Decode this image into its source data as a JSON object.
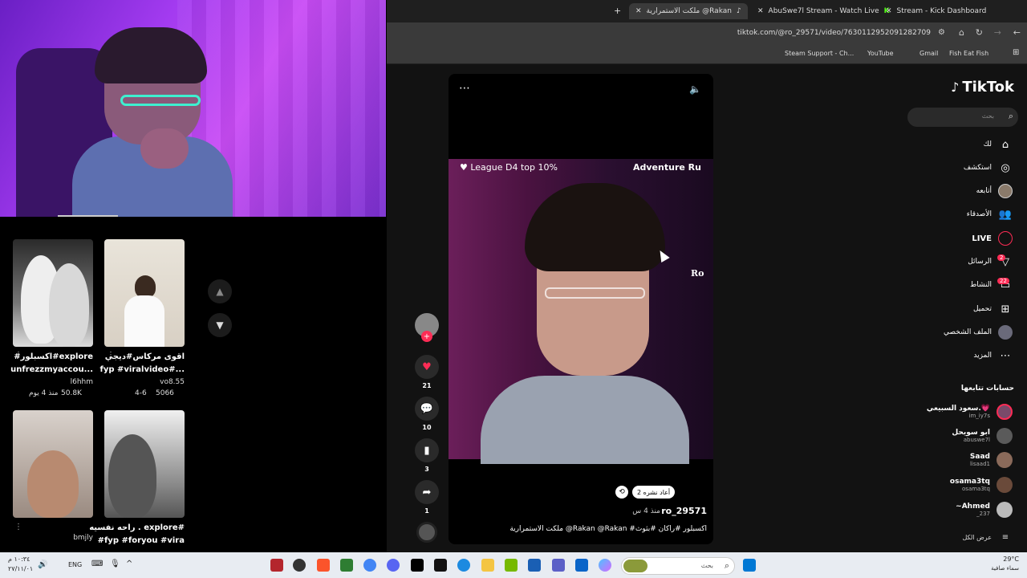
{
  "browser": {
    "tabs": [
      {
        "label": "ملكت الاستمرارية @Rakan",
        "active": true
      },
      {
        "label": "AbuSwe7l Stream - Watch Live",
        "active": false
      },
      {
        "label": "Stream - Kick Dashboard",
        "active": false
      }
    ],
    "url": "tiktok.com/@ro_29571/video/7630112952091282709",
    "bookmarks": [
      "Steam Support - Ch...",
      "YouTube",
      "Gmail",
      "Fish Eat Fish"
    ]
  },
  "feed": {
    "videos": [
      {
        "title": "#اكسبلور#explore",
        "title2": "unfrezzmyaccou...",
        "author": "l6hhm",
        "likes": "50.8K",
        "age": "منذ 4 يوم"
      },
      {
        "title": "اقوى مركاس#ديجي",
        "title2": "fyp #viralvideo#...",
        "author": "vo8.55",
        "likes": "5066",
        "age": "4-6"
      },
      {
        "title": "",
        "title2": "",
        "author": "bmjly",
        "likes": "",
        "age": ""
      },
      {
        "title": "راحه نفسيه . explore#",
        "title2": "#fyp #foryou #vira",
        "author": "",
        "likes": "",
        "age": ""
      }
    ]
  },
  "player": {
    "league": "League D4 top 10%",
    "game": "Adventure Ru",
    "ro_label": "Ro",
    "reposts": "2 أعاد نشره",
    "username": "ro_29571",
    "posted": "منذ 4 س",
    "caption": "ملكت الاستمرارية @Rakan @Rakan #اكسبلور #راكان #بثوث"
  },
  "actions": {
    "likes": "21",
    "comments": "10",
    "saves": "3",
    "shares": "1"
  },
  "sidebar": {
    "logo": "TikTok",
    "search_placeholder": "بحث",
    "items": [
      {
        "label": "لك",
        "icon": "home-icon"
      },
      {
        "label": "استكشف",
        "icon": "compass-icon"
      },
      {
        "label": "أتابعه",
        "icon": "avatar"
      },
      {
        "label": "الأصدقاء",
        "icon": "friends-icon"
      },
      {
        "label": "LIVE",
        "icon": "live-icon"
      },
      {
        "label": "الرسائل",
        "icon": "messages-icon",
        "badge": "2"
      },
      {
        "label": "النشاط",
        "icon": "activity-icon",
        "badge": "22"
      },
      {
        "label": "تحميل",
        "icon": "upload-icon"
      },
      {
        "label": "الملف الشخصي",
        "icon": "profile-icon"
      },
      {
        "label": "المزيد",
        "icon": "more-icon"
      }
    ],
    "following_title": "حسابات تتابعها",
    "following": [
      {
        "name": "سعود السبيعي.💗",
        "handle": "im_iy7s"
      },
      {
        "name": "ابو سويحل",
        "handle": "abuswe7l"
      },
      {
        "name": "Saad",
        "handle": "lisaad1"
      },
      {
        "name": "osama3tq",
        "handle": "osama3tq"
      },
      {
        "name": "~Ahmed",
        "handle": "_237"
      }
    ],
    "see_all": "عرض الكل"
  },
  "taskbar": {
    "time": "١٠:٣٤ م",
    "date": "٢٧/١١/٠١",
    "lang": "ENG",
    "search_placeholder": "بحث",
    "weather_temp": "29°C",
    "weather_desc": "سماء صافية"
  },
  "colors": {
    "accent": "#fe2c55",
    "bg": "#121212"
  }
}
